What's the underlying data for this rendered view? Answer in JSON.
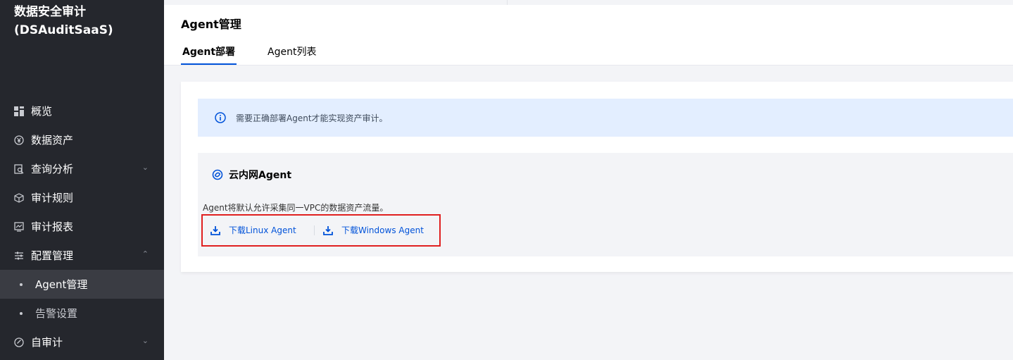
{
  "app": {
    "title_line1": "数据安全审计",
    "title_line2": "(DSAuditSaaS)"
  },
  "sidebar": {
    "items": [
      {
        "label": "概览",
        "icon": "dashboard-icon"
      },
      {
        "label": "数据资产",
        "icon": "yen-circle-icon"
      },
      {
        "label": "查询分析",
        "icon": "search-doc-icon",
        "chevron": "down"
      },
      {
        "label": "审计规则",
        "icon": "cube-icon"
      },
      {
        "label": "审计报表",
        "icon": "chart-icon"
      },
      {
        "label": "配置管理",
        "icon": "sliders-icon",
        "chevron": "up"
      },
      {
        "label": "Agent管理",
        "sub": true,
        "active": true
      },
      {
        "label": "告警设置",
        "sub": true
      },
      {
        "label": "自审计",
        "icon": "check-circle-icon",
        "chevron": "down"
      }
    ]
  },
  "header": {
    "title": "Agent管理",
    "tabs": [
      {
        "label": "Agent部署",
        "active": true
      },
      {
        "label": "Agent列表",
        "active": false
      }
    ]
  },
  "alert": {
    "text": "需要正确部署Agent才能实现资产审计。"
  },
  "agent_panel": {
    "title": "云内网Agent",
    "description": "Agent将默认允许采集同一VPC的数据资产流量。",
    "links": [
      {
        "label": "下载Linux Agent"
      },
      {
        "label": "下载Windows Agent"
      }
    ]
  },
  "colors": {
    "accent": "#0052d9",
    "sidebar_bg": "#25272d",
    "highlight_box": "#e02020",
    "alert_bg": "#e3eeff"
  }
}
